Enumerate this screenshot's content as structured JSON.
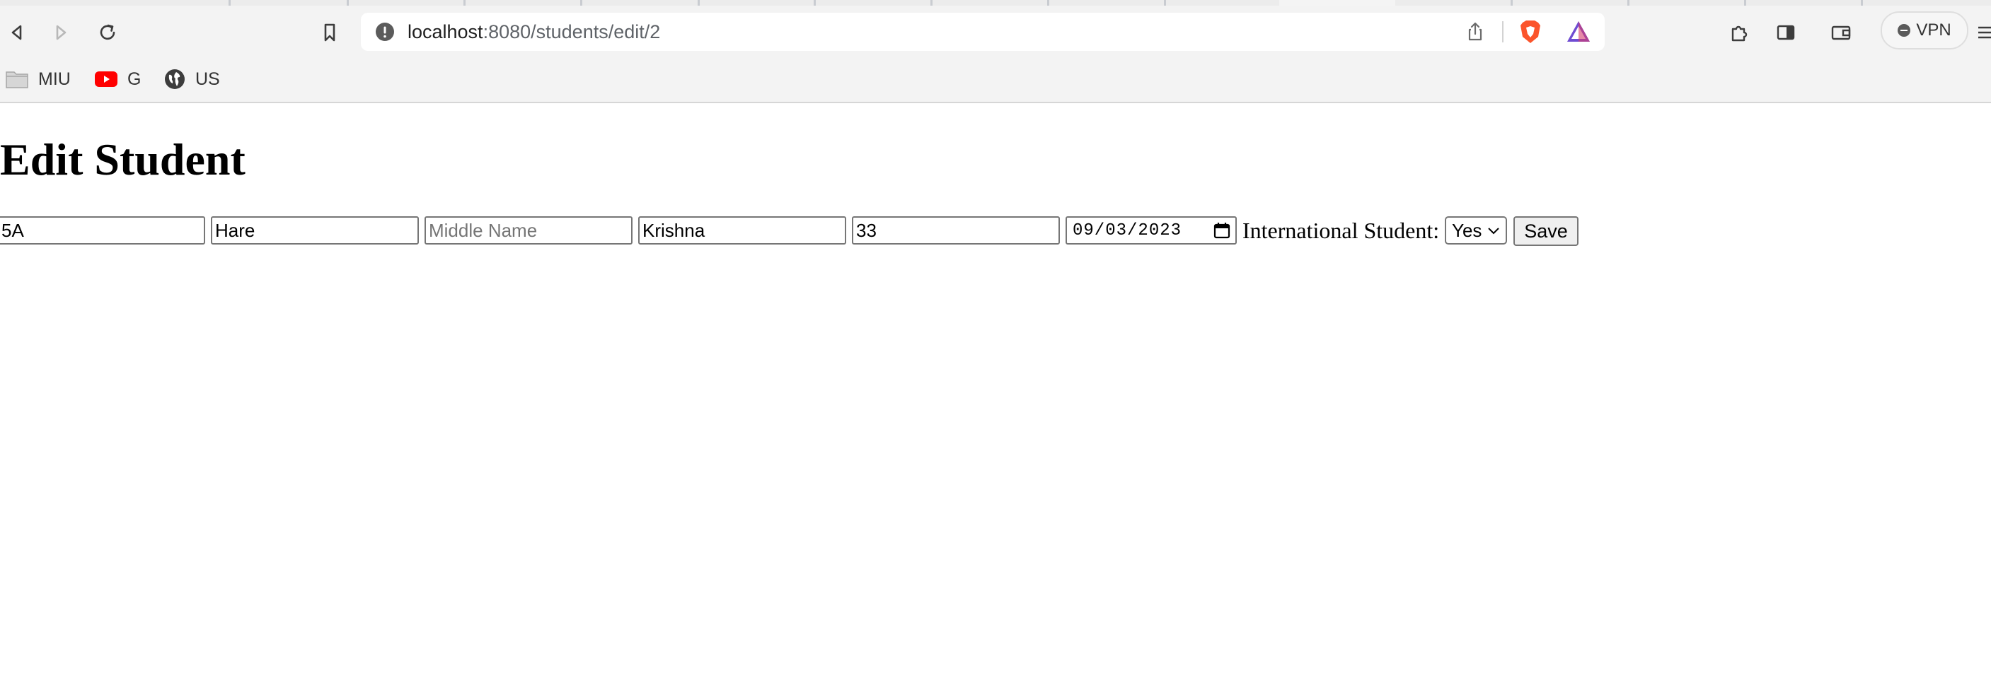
{
  "browser": {
    "url_host": "localhost",
    "url_path": ":8080/students/edit/2",
    "vpn_label": "VPN",
    "bookmarks": [
      {
        "label": "MIU",
        "icon": "folder-icon"
      },
      {
        "label": "G",
        "icon": "youtube-icon"
      },
      {
        "label": "US",
        "icon": "globe-icon"
      }
    ]
  },
  "page": {
    "title": "Edit Student",
    "form": {
      "student_id": {
        "value": "5A"
      },
      "first_name": {
        "value": "Hare"
      },
      "middle_name": {
        "value": "",
        "placeholder": "Middle Name"
      },
      "last_name": {
        "value": "Krishna"
      },
      "age": {
        "value": "33"
      },
      "date": {
        "value": "09/03/2023"
      },
      "international_label": "International Student:",
      "international_selected": "Yes",
      "save_label": "Save"
    }
  },
  "colors": {
    "youtube_red": "#ff0000",
    "brave_orange": "#fb542b",
    "rewards_purple": "#6f4cd2"
  }
}
